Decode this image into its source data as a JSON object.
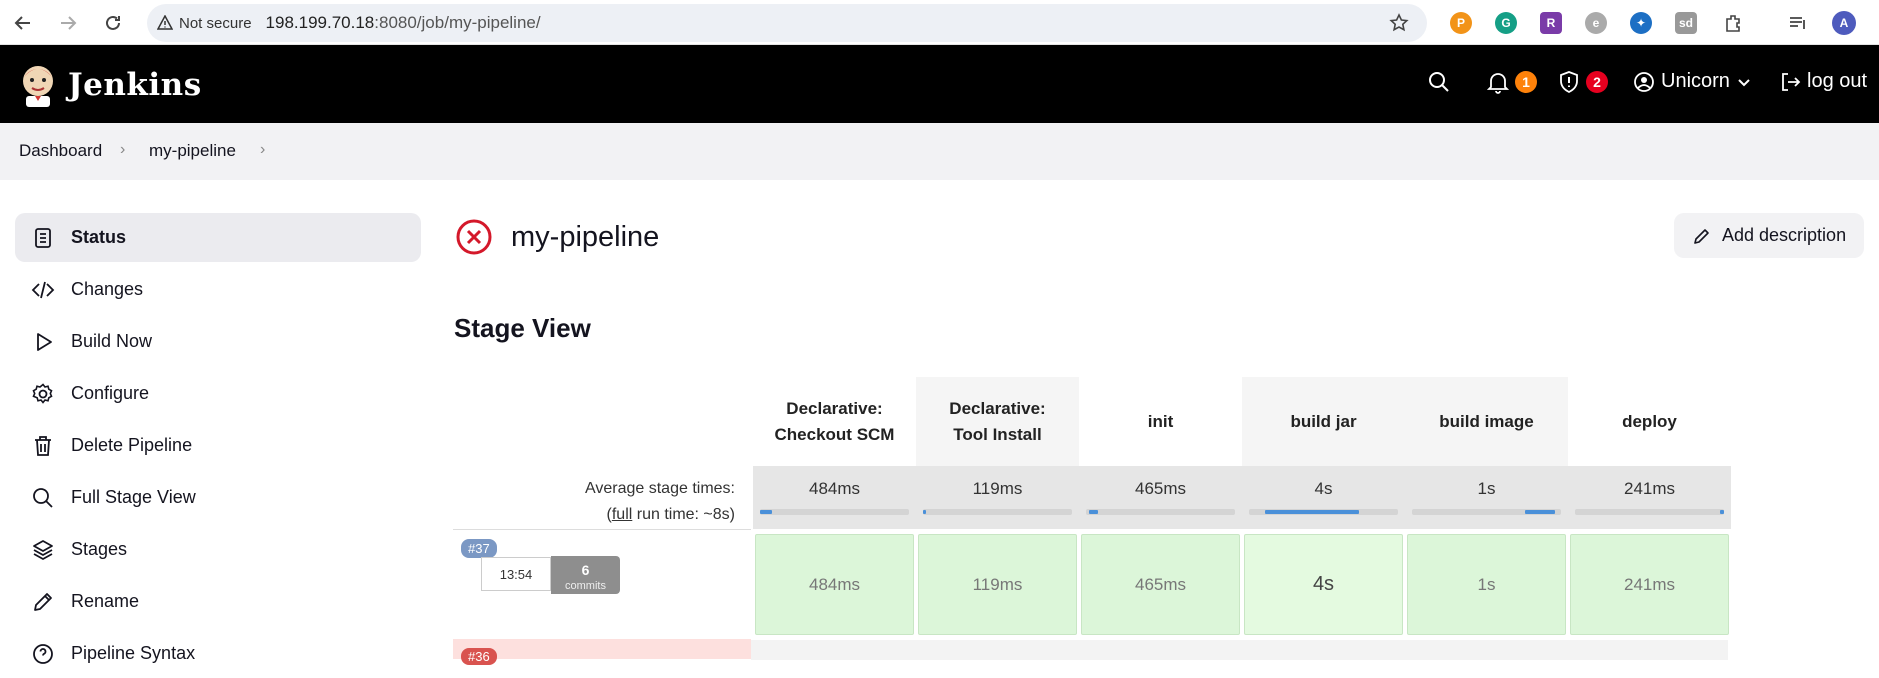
{
  "browser": {
    "security_label": "Not secure",
    "url_host": "198.199.70.18",
    "url_rest": ":8080/job/my-pipeline/",
    "profile_initial": "A"
  },
  "header": {
    "title": "Jenkins",
    "notifications_count": "1",
    "security_count": "2",
    "user": "Unicorn",
    "logout": "log out"
  },
  "breadcrumb": {
    "items": [
      "Dashboard",
      "my-pipeline"
    ]
  },
  "sidebar": {
    "items": [
      {
        "label": "Status",
        "icon": "document-icon"
      },
      {
        "label": "Changes",
        "icon": "code-icon"
      },
      {
        "label": "Build Now",
        "icon": "play-icon"
      },
      {
        "label": "Configure",
        "icon": "gear-icon"
      },
      {
        "label": "Delete Pipeline",
        "icon": "trash-icon"
      },
      {
        "label": "Full Stage View",
        "icon": "search-icon"
      },
      {
        "label": "Stages",
        "icon": "layers-icon"
      },
      {
        "label": "Rename",
        "icon": "pencil-icon"
      },
      {
        "label": "Pipeline Syntax",
        "icon": "help-icon"
      }
    ]
  },
  "main": {
    "title": "my-pipeline",
    "status": "failed",
    "add_description": "Add description",
    "stage_view_heading": "Stage View"
  },
  "stage_view": {
    "stages": [
      {
        "line1": "Declarative:",
        "line2": "Checkout SCM",
        "avg": "484ms",
        "bar_fraction": 0.08,
        "bar_offset": 0.0
      },
      {
        "line1": "Declarative:",
        "line2": "Tool Install",
        "avg": "119ms",
        "bar_fraction": 0.02,
        "bar_offset": 0.0
      },
      {
        "line1": "init",
        "line2": "",
        "avg": "465ms",
        "bar_fraction": 0.06,
        "bar_offset": 0.02
      },
      {
        "line1": "build jar",
        "line2": "",
        "avg": "4s",
        "bar_fraction": 0.63,
        "bar_offset": 0.11
      },
      {
        "line1": "build image",
        "line2": "",
        "avg": "1s",
        "bar_fraction": 0.2,
        "bar_offset": 0.76
      },
      {
        "line1": "deploy",
        "line2": "",
        "avg": "241ms",
        "bar_fraction": 0.03,
        "bar_offset": 0.97
      }
    ],
    "avg_label_line1": "Average stage times:",
    "avg_label_prefix": "(",
    "avg_label_link": "full",
    "avg_label_suffix": " run time: ~8s)",
    "builds": [
      {
        "number": "#37",
        "time": "13:54",
        "commits": "6",
        "commits_word": "commits",
        "cells": [
          "484ms",
          "119ms",
          "465ms",
          "4s",
          "1s",
          "241ms"
        ]
      },
      {
        "number": "#36"
      }
    ]
  },
  "colors": {
    "header_bg": "#000000",
    "failed_red": "#d4182a",
    "success_cell": "#dcf6d9",
    "notif_badge": "#fe820a",
    "security_badge": "#e6001f"
  }
}
